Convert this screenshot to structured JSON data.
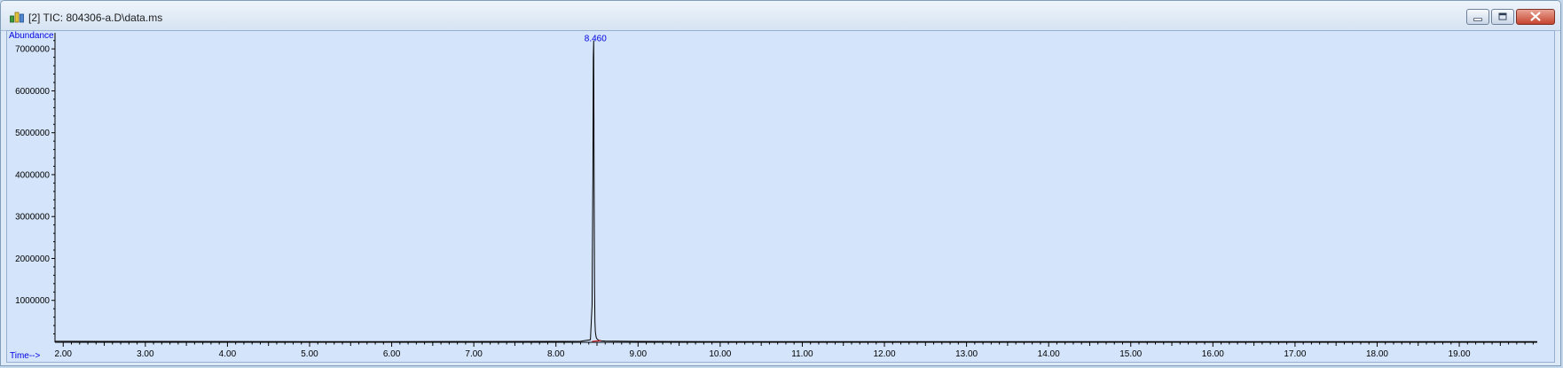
{
  "window": {
    "title": "[2] TIC: 804306-a.D\\data.ms",
    "icon": "chromatogram-app-icon",
    "buttons": {
      "minimize": "minimize-icon",
      "restore": "restore-icon",
      "close": "close-icon"
    }
  },
  "colors": {
    "plot_background": "#d4e5fb",
    "axis": "#000000",
    "trace": "#000000",
    "baseline_marker": "#cc0000",
    "annotation": "#0000e0"
  },
  "chart_data": {
    "type": "line",
    "ylabel": "Abundance",
    "xlabel": "Time-->",
    "xlim": [
      1.9,
      19.95
    ],
    "ylim": [
      0,
      7300000
    ],
    "x_ticks": [
      "2.00",
      "3.00",
      "4.00",
      "5.00",
      "6.00",
      "7.00",
      "8.00",
      "9.00",
      "10.00",
      "11.00",
      "12.00",
      "13.00",
      "14.00",
      "15.00",
      "16.00",
      "17.00",
      "18.00",
      "19.00"
    ],
    "y_ticks": [
      "1000000",
      "2000000",
      "3000000",
      "4000000",
      "5000000",
      "6000000",
      "7000000"
    ],
    "grid": false,
    "series": [
      {
        "x": [
          1.9,
          2.5,
          3.0,
          4.0,
          5.0,
          6.0,
          7.0,
          8.0,
          8.3,
          8.42,
          8.44,
          8.45,
          8.455,
          8.46,
          8.465,
          8.47,
          8.475,
          8.48,
          8.49,
          8.5,
          8.52,
          8.55,
          8.6,
          9.0,
          10.0,
          12.0,
          14.0,
          16.0,
          18.0,
          19.95
        ],
        "y": [
          25000,
          22000,
          20000,
          18000,
          17000,
          17000,
          18000,
          20000,
          25000,
          60000,
          900000,
          4000000,
          6800000,
          7200000,
          4000000,
          1300000,
          500000,
          250000,
          120000,
          80000,
          50000,
          35000,
          28000,
          20000,
          17000,
          16000,
          16000,
          15000,
          15000,
          15000
        ]
      }
    ],
    "annotations": [
      {
        "x": 8.46,
        "y": 7200000,
        "text": "8.460"
      }
    ]
  }
}
